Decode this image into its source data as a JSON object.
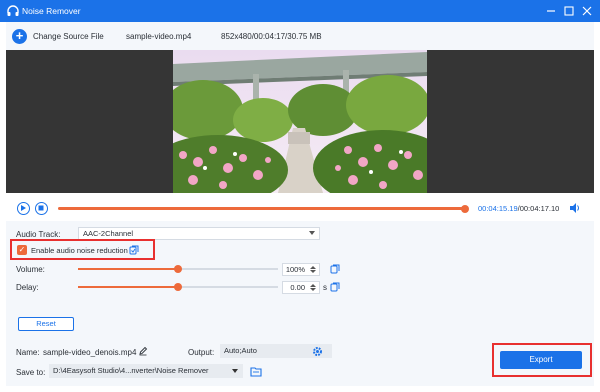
{
  "window": {
    "title": "Noise Remover"
  },
  "topbar": {
    "change_source_label": "Change Source File",
    "file_name": "sample-video.mp4",
    "file_info": "852x480/00:04:17/30.75 MB"
  },
  "playback": {
    "current_time": "00:04:15.19",
    "total_time": "00:04:17.10",
    "progress_fraction": 0.993
  },
  "settings": {
    "audio_track_label": "Audio Track:",
    "audio_track_value": "AAC-2Channel",
    "noise_reduction_label": "Enable audio noise reduction",
    "noise_reduction_checked": true,
    "volume_label": "Volume:",
    "volume_value": "100%",
    "volume_fraction": 0.5,
    "delay_label": "Delay:",
    "delay_value": "0.00",
    "delay_unit": "s",
    "delay_fraction": 0.5,
    "reset_label": "Reset"
  },
  "output": {
    "name_label": "Name:",
    "name_value": "sample-video_denois.mp4",
    "output_label": "Output:",
    "output_value": "Auto;Auto",
    "save_to_label": "Save to:",
    "save_to_value": "D:\\4Easysoft Studio\\4...nverter\\Noise Remover",
    "export_label": "Export"
  },
  "colors": {
    "accent": "#1b72e8",
    "orange": "#ed6a3b",
    "highlight": "#e8302f"
  }
}
